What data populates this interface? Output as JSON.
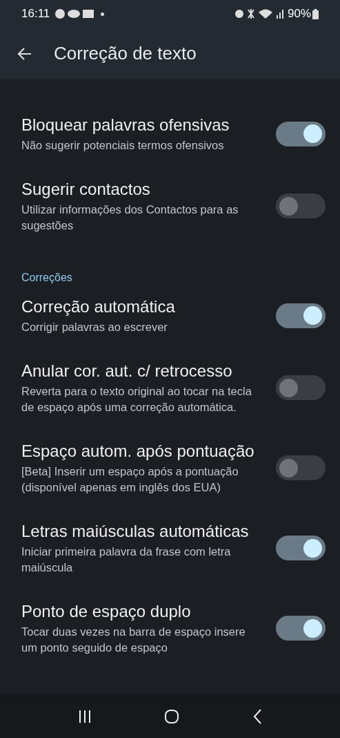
{
  "status_bar": {
    "time": "16:11",
    "battery": "90%"
  },
  "app_bar": {
    "title": "Correção de texto"
  },
  "items": [
    {
      "kind": "setting",
      "title": "Bloquear palavras ofensivas",
      "summary": "Não sugerir potenciais termos ofensivos",
      "on": true
    },
    {
      "kind": "setting",
      "title": "Sugerir contactos",
      "summary": "Utilizar informações dos Contactos para as sugestões",
      "on": false
    },
    {
      "kind": "header",
      "title": "Correções"
    },
    {
      "kind": "setting",
      "title": "Correção automática",
      "summary": "Corrigir palavras ao escrever",
      "on": true
    },
    {
      "kind": "setting",
      "title": "Anular cor. aut. c/ retrocesso",
      "summary": "Reverta para o texto original ao tocar na tecla de espaço após uma correção automática.",
      "on": false
    },
    {
      "kind": "setting",
      "title": "Espaço autom. após pontuação",
      "summary": "[Beta] Inserir um espaço após a pontuação (disponível apenas em inglês dos EUA)",
      "on": false
    },
    {
      "kind": "setting",
      "title": "Letras maiúsculas automáticas",
      "summary": "Iniciar primeira palavra da frase com letra maiúscula",
      "on": true
    },
    {
      "kind": "setting",
      "title": "Ponto de espaço duplo",
      "summary": "Tocar duas vezes na barra de espaço insere um ponto seguido de espaço",
      "on": true
    }
  ]
}
